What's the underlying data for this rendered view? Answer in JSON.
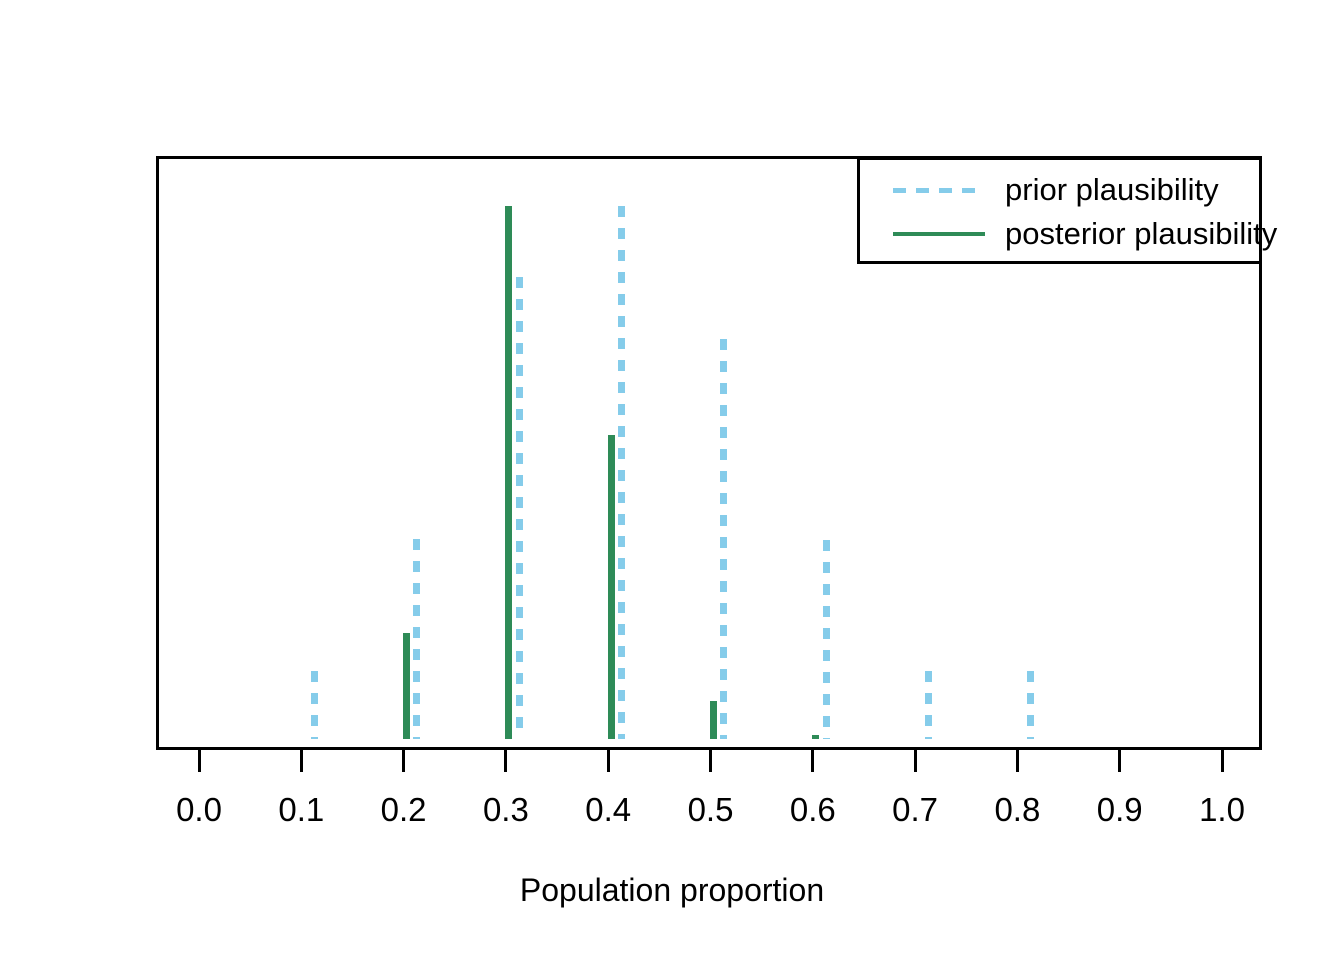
{
  "chart_data": {
    "type": "bar",
    "title": "",
    "subtitle": "",
    "xlabel": "Population proportion",
    "ylabel": "",
    "xlim": [
      -0.042,
      1.039
    ],
    "ylim": [
      0,
      1
    ],
    "grid": false,
    "legend_position": "top-right",
    "x_ticks": [
      "0.0",
      "0.1",
      "0.2",
      "0.3",
      "0.4",
      "0.5",
      "0.6",
      "0.7",
      "0.8",
      "0.9",
      "1.0"
    ],
    "x_tick_values": [
      0.0,
      0.1,
      0.2,
      0.3,
      0.4,
      0.5,
      0.6,
      0.7,
      0.8,
      0.9,
      1.0
    ],
    "y_axis_visible": false,
    "colors": {
      "prior": "#85ccea",
      "posterior": "#2e8b57",
      "frame": "#000000",
      "background": "#ffffff"
    },
    "series": [
      {
        "name": "prior plausibility",
        "style": "dashed",
        "color": "#85ccea",
        "x": [
          0.11,
          0.21,
          0.31,
          0.41,
          0.51,
          0.61,
          0.71,
          0.81
        ],
        "values": [
          0.121,
          0.356,
          0.821,
          0.947,
          0.711,
          0.354,
          0.121,
          0.121
        ]
      },
      {
        "name": "posterior plausibility",
        "style": "solid",
        "color": "#2e8b57",
        "x": [
          0.2,
          0.3,
          0.4,
          0.5,
          0.6
        ],
        "values": [
          0.189,
          0.947,
          0.54,
          0.067,
          0.007
        ]
      }
    ]
  },
  "legend": {
    "entries": [
      {
        "label": "prior plausibility",
        "style": "dashed",
        "color": "#85ccea"
      },
      {
        "label": "posterior plausibility",
        "style": "solid",
        "color": "#2e8b57"
      }
    ]
  },
  "axis": {
    "x_title": "Population proportion"
  }
}
